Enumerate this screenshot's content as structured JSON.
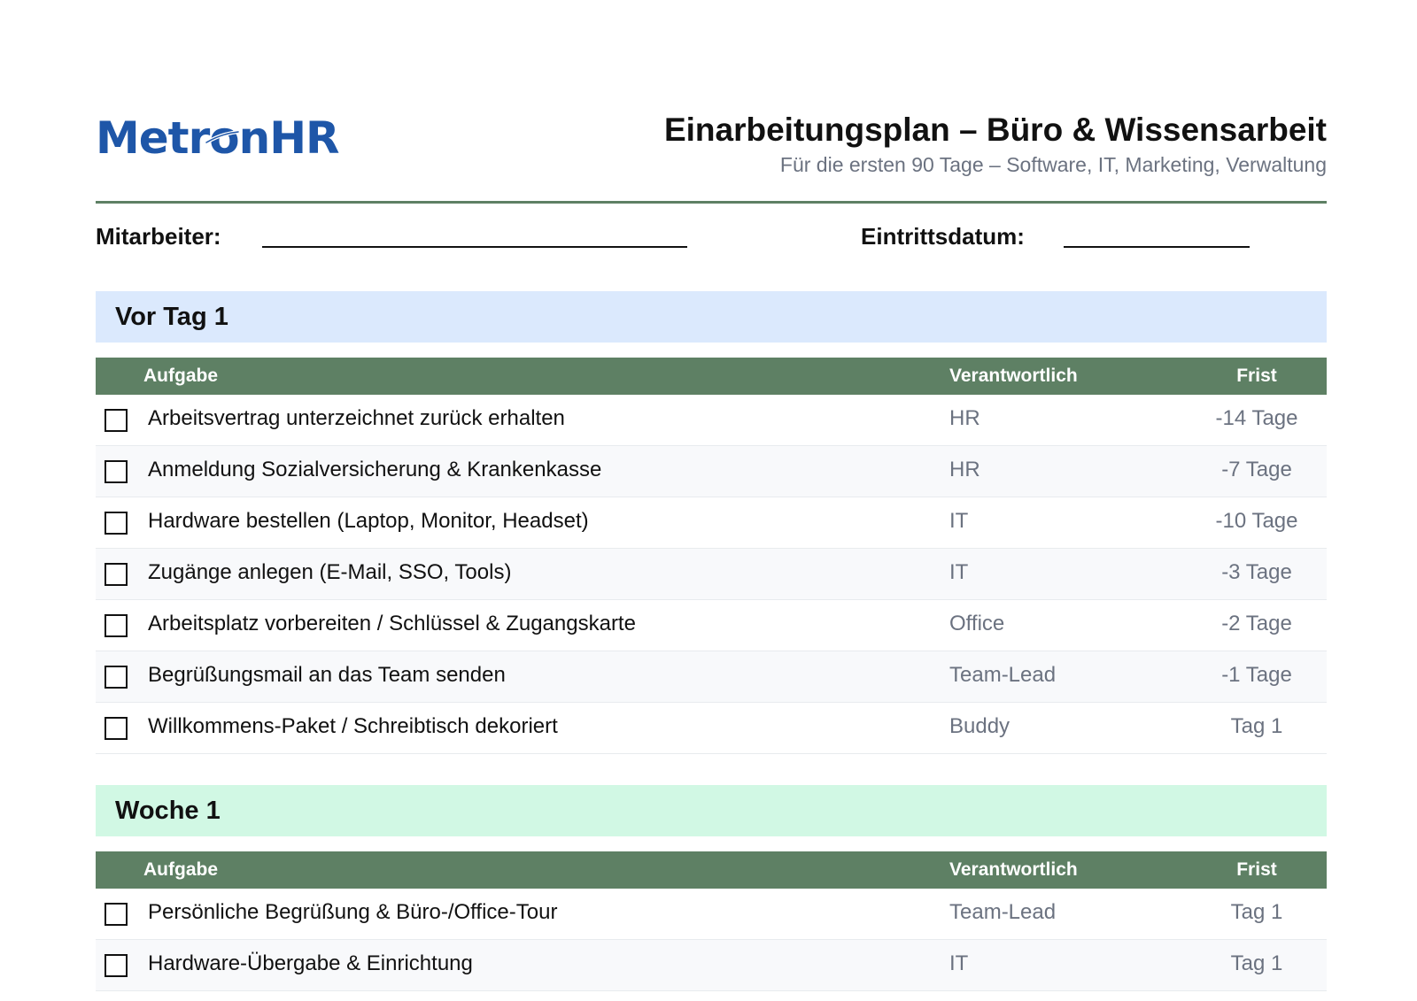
{
  "header": {
    "logo_text_a": "Metr",
    "logo_text_o": "o",
    "logo_text_b": "nHR",
    "title": "Einarbeitungsplan – Büro & Wissensarbeit",
    "subtitle": "Für die ersten 90 Tage – Software, IT, Marketing, Verwaltung"
  },
  "colors": {
    "brand": "#1e56a8",
    "accent_green": "#5e8064",
    "band_blue": "#dbe9fd",
    "band_green": "#d1f8e4",
    "muted_text": "#6b7280"
  },
  "fields": {
    "employee_label": "Mitarbeiter:",
    "start_date_label": "Eintrittsdatum:"
  },
  "table_headers": {
    "task": "Aufgabe",
    "responsible": "Verantwortlich",
    "due": "Frist"
  },
  "sections": [
    {
      "title": "Vor Tag 1",
      "rows": [
        {
          "task": "Arbeitsvertrag unterzeichnet zurück erhalten",
          "responsible": "HR",
          "due": "-14 Tage"
        },
        {
          "task": "Anmeldung Sozialversicherung & Krankenkasse",
          "responsible": "HR",
          "due": "-7 Tage"
        },
        {
          "task": "Hardware bestellen (Laptop, Monitor, Headset)",
          "responsible": "IT",
          "due": "-10 Tage"
        },
        {
          "task": "Zugänge anlegen (E-Mail, SSO, Tools)",
          "responsible": "IT",
          "due": "-3 Tage"
        },
        {
          "task": "Arbeitsplatz vorbereiten / Schlüssel & Zugangskarte",
          "responsible": "Office",
          "due": "-2 Tage"
        },
        {
          "task": "Begrüßungsmail an das Team senden",
          "responsible": "Team-Lead",
          "due": "-1 Tage"
        },
        {
          "task": "Willkommens-Paket / Schreibtisch dekoriert",
          "responsible": "Buddy",
          "due": "Tag 1"
        }
      ]
    },
    {
      "title": "Woche 1",
      "rows": [
        {
          "task": "Persönliche Begrüßung & Büro-/Office-Tour",
          "responsible": "Team-Lead",
          "due": "Tag 1"
        },
        {
          "task": "Hardware-Übergabe & Einrichtung",
          "responsible": "IT",
          "due": "Tag 1"
        }
      ]
    }
  ]
}
